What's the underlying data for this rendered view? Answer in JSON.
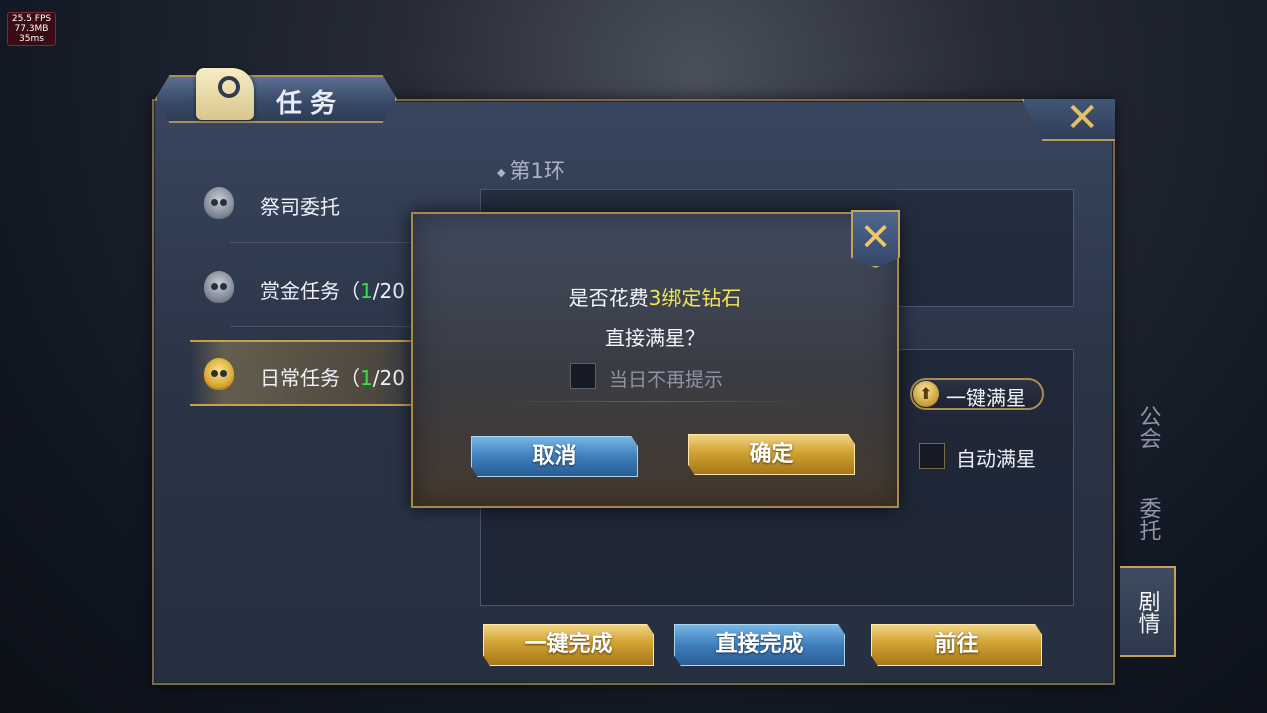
{
  "debug": {
    "fps": "25.5 FPS",
    "memory": "77.3MB",
    "latency": "35ms"
  },
  "window": {
    "title": "任务",
    "close_icon": "close-icon"
  },
  "task_list": [
    {
      "name": "祭司委托",
      "progress_current": "",
      "progress_rest": "",
      "icon": "skull-icon",
      "active": false
    },
    {
      "name": "赏金任务（",
      "progress_current": "1",
      "progress_rest": "/20",
      "icon": "skull-icon",
      "active": false
    },
    {
      "name": "日常任务（",
      "progress_current": "1",
      "progress_rest": "/20",
      "icon": "gold-skull-icon",
      "active": true
    }
  ],
  "content": {
    "ring_label": "第1环",
    "one_key_star_label": "一键满星",
    "auto_star_label": "自动满星"
  },
  "actions": {
    "one_key_complete": "一键完成",
    "direct_complete": "直接完成",
    "goto": "前往"
  },
  "side_tabs": [
    {
      "label": "公会",
      "active": false
    },
    {
      "label": "委托",
      "active": false
    },
    {
      "label": "剧情",
      "active": true
    }
  ],
  "dialog": {
    "line1_prefix": "是否花费",
    "line1_highlight": "3绑定钻石",
    "line2": "直接满星？",
    "checkbox_label": "当日不再提示",
    "cancel_label": "取消",
    "confirm_label": "确定"
  },
  "colors": {
    "highlight_yellow": "#f4e552",
    "progress_green": "#36e24a",
    "gold_border": "#a8894a"
  }
}
